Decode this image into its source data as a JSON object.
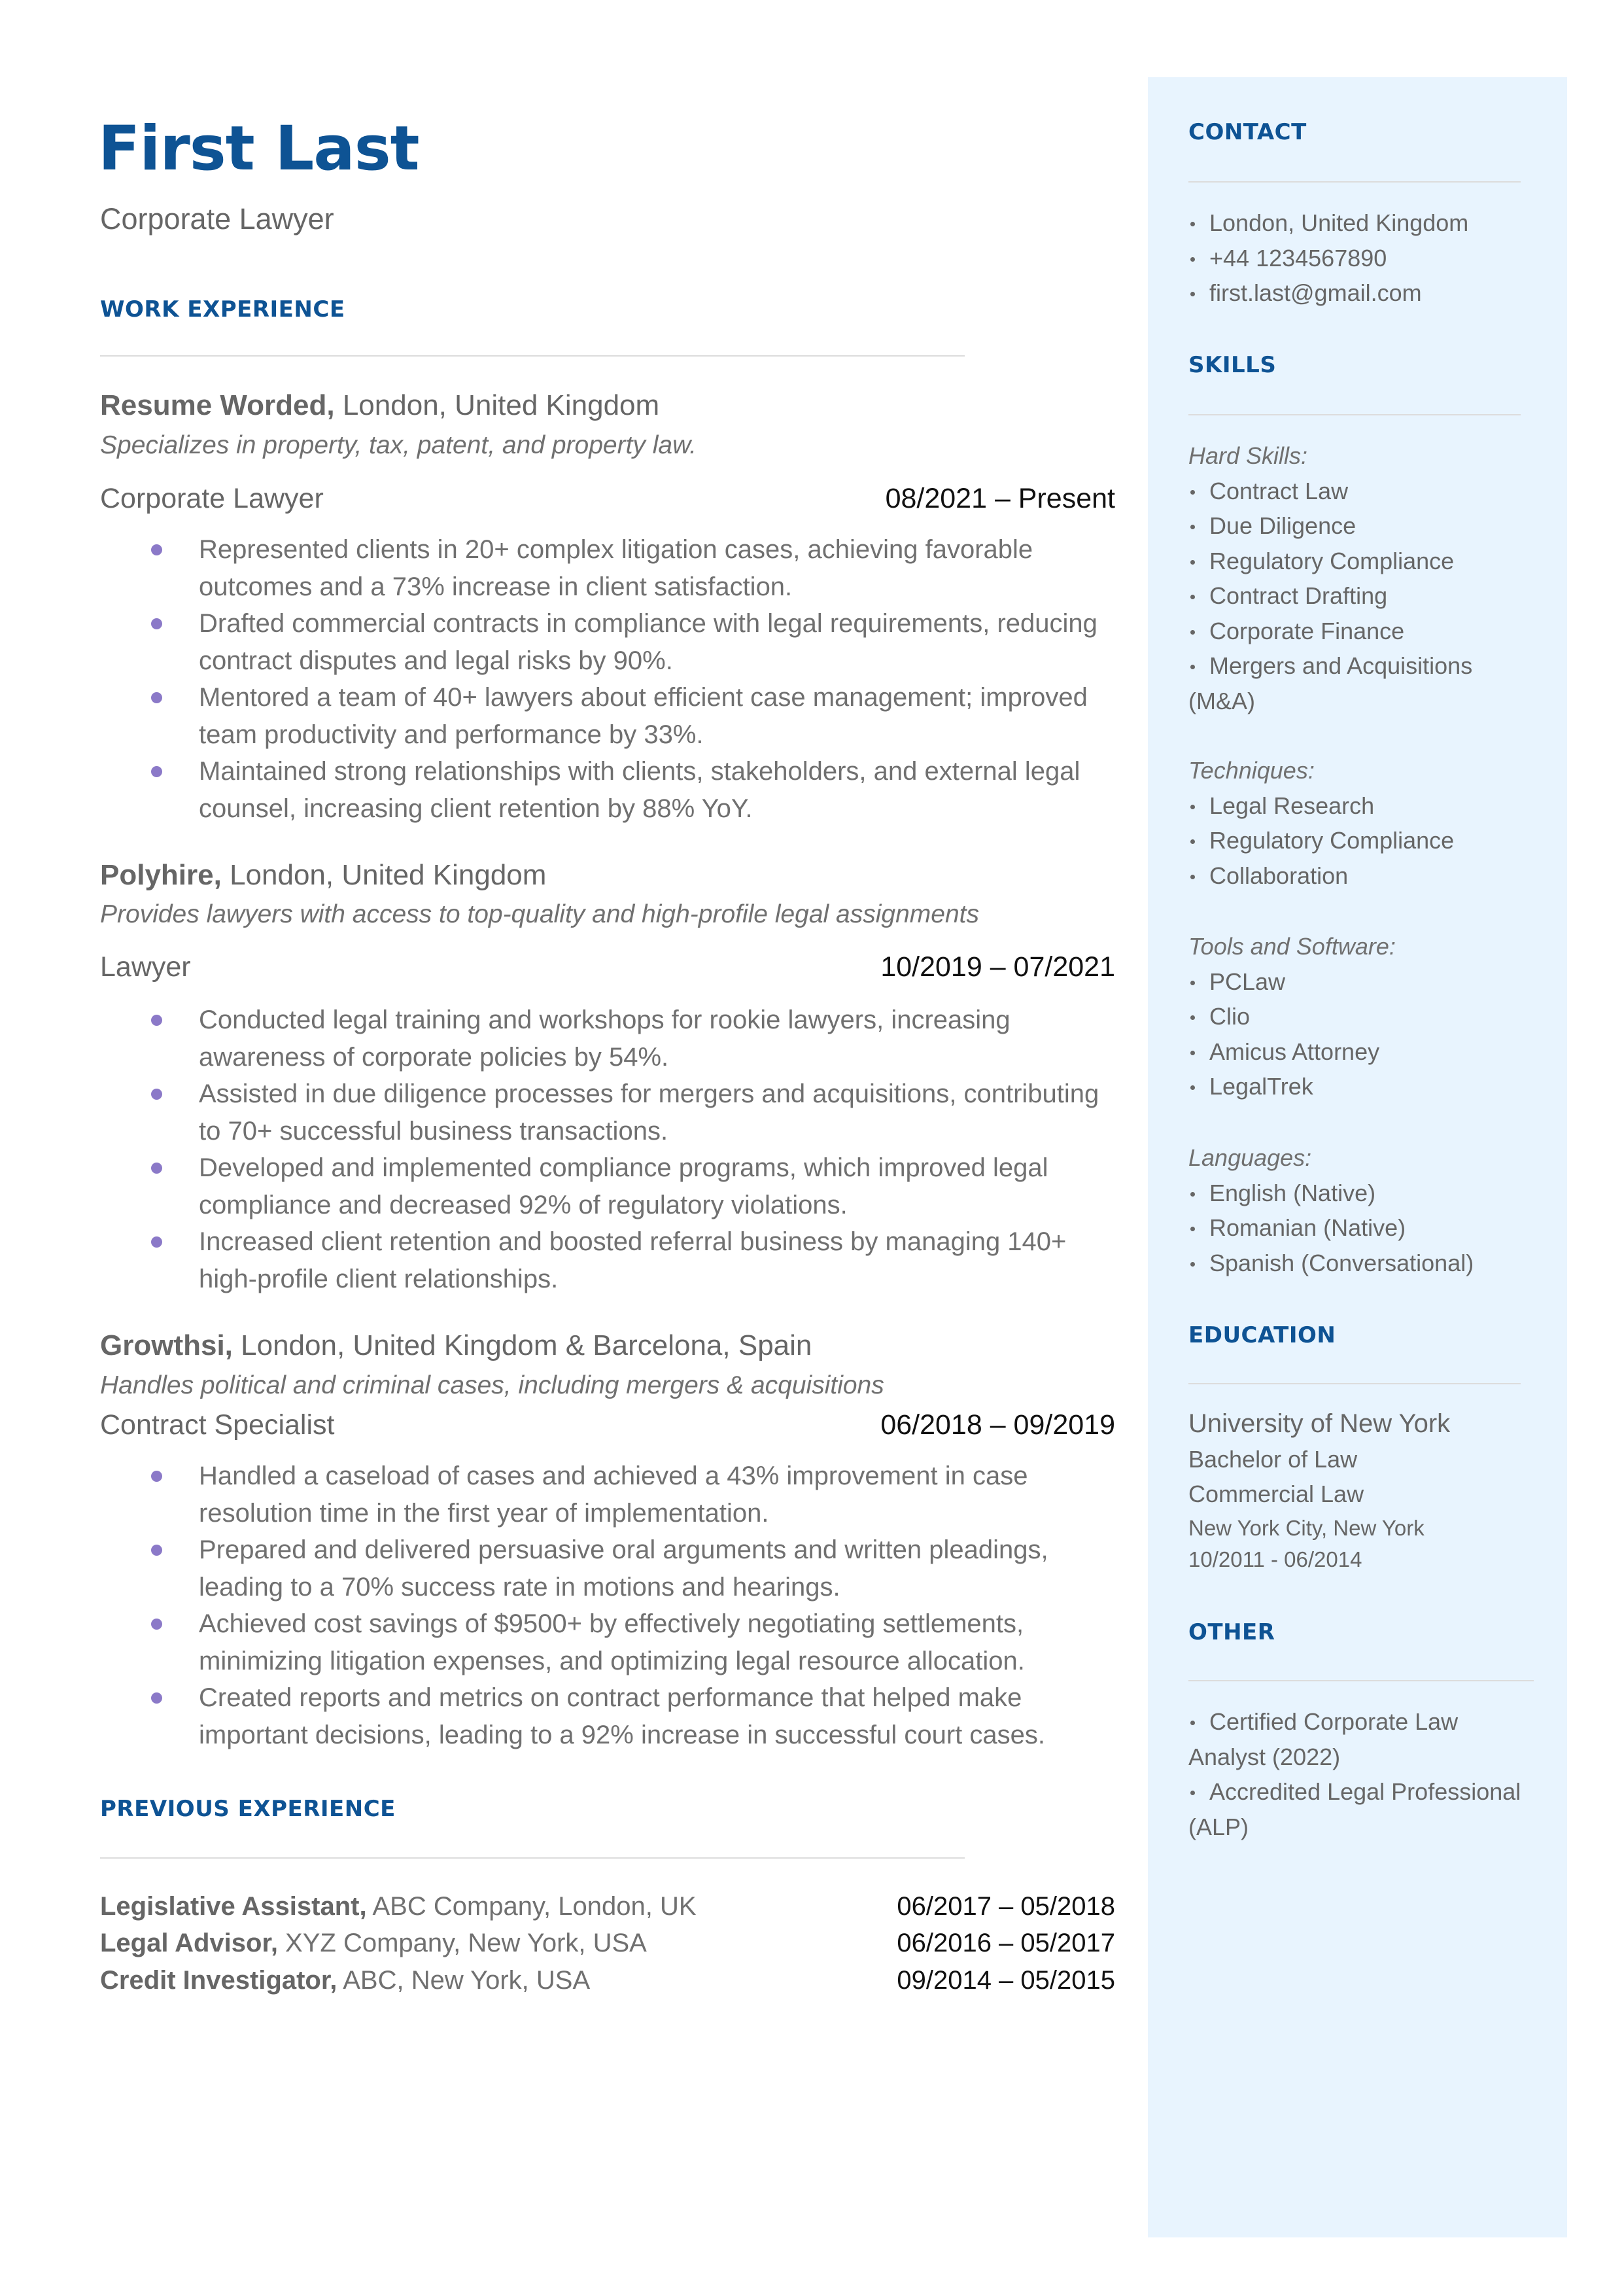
{
  "header": {
    "name": "First Last",
    "title": "Corporate Lawyer"
  },
  "colors": {
    "accent": "#0e5394",
    "bullet": "#8b79c8",
    "sidebar_bg": "#e8f4fe",
    "text": "#666666"
  },
  "work_experience": {
    "heading": "WORK EXPERIENCE",
    "jobs": [
      {
        "company": "Resume Worded,",
        "location": " London, United Kingdom",
        "description": "Specializes in property, tax, patent, and property law.",
        "role": "Corporate Lawyer",
        "dates": "08/2021 – Present",
        "bullets": [
          "Represented clients in 20+ complex litigation cases, achieving favorable outcomes and a 73% increase in client satisfaction.",
          "Drafted commercial contracts in compliance with legal requirements, reducing contract disputes and legal risks by 90%.",
          "Mentored a team of 40+ lawyers about efficient case management; improved team productivity and performance by 33%.",
          "Maintained strong relationships with clients, stakeholders, and external legal counsel, increasing client retention by 88% YoY."
        ]
      },
      {
        "company": "Polyhire,",
        "location": " London, United Kingdom",
        "description": "Provides lawyers with access to top-quality and high-profile legal assignments",
        "role": "Lawyer",
        "dates": "10/2019 – 07/2021",
        "bullets": [
          "Conducted legal training and workshops for rookie lawyers, increasing awareness of corporate policies by 54%.",
          "Assisted in due diligence processes for mergers and acquisitions, contributing to 70+ successful business transactions.",
          "Developed and implemented compliance programs, which improved legal compliance and decreased 92% of regulatory violations.",
          "Increased client retention and boosted referral business by managing 140+ high-profile client relationships."
        ]
      },
      {
        "company": "Growthsi,",
        "location": " London, United Kingdom & Barcelona, Spain",
        "description": "Handles political and criminal cases, including mergers & acquisitions",
        "role": "Contract Specialist",
        "dates": "06/2018 – 09/2019",
        "bullets": [
          "Handled a caseload of cases and achieved a 43% improvement in case resolution time in the first year of implementation.",
          "Prepared and delivered persuasive oral arguments and written pleadings, leading to a 70% success rate in motions and hearings.",
          "Achieved cost savings of $9500+ by effectively negotiating settlements, minimizing litigation expenses, and optimizing legal resource allocation.",
          "Created reports and metrics on contract performance that helped make important decisions, leading to a 92% increase in successful court cases."
        ]
      }
    ]
  },
  "previous_experience": {
    "heading": "PREVIOUS EXPERIENCE",
    "items": [
      {
        "role": "Legislative Assistant,",
        "org": " ABC Company, London, UK",
        "dates": "06/2017 – 05/2018"
      },
      {
        "role": "Legal Advisor,",
        "org": " XYZ Company, New York, USA",
        "dates": "06/2016 – 05/2017"
      },
      {
        "role": "Credit Investigator,",
        "org": " ABC, New York, USA",
        "dates": "09/2014 – 05/2015"
      }
    ]
  },
  "sidebar": {
    "contact": {
      "heading": "CONTACT",
      "items": [
        "London, United Kingdom",
        "+44 1234567890",
        "first.last@gmail.com"
      ]
    },
    "skills": {
      "heading": "SKILLS",
      "groups": [
        {
          "label": "Hard Skills:",
          "items": [
            "Contract Law",
            "Due Diligence",
            "Regulatory Compliance",
            "Contract Drafting",
            "Corporate Finance",
            "Mergers and Acquisitions (M&A)"
          ]
        },
        {
          "label": "Techniques:",
          "items": [
            "Legal Research",
            "Regulatory Compliance",
            "Collaboration"
          ]
        },
        {
          "label": "Tools and Software:",
          "items": [
            "PCLaw",
            "Clio",
            "Amicus Attorney",
            "LegalTrek"
          ]
        },
        {
          "label": "Languages:",
          "items": [
            "English (Native)",
            "Romanian (Native)",
            "Spanish (Conversational)"
          ]
        }
      ]
    },
    "education": {
      "heading": "EDUCATION",
      "school": "University of New York",
      "degree": "Bachelor of Law",
      "field": "Commercial Law",
      "location": "New York City, New York",
      "dates": "10/2011 - 06/2014"
    },
    "other": {
      "heading": "OTHER",
      "items": [
        "Certified Corporate Law Analyst (2022)",
        "Accredited Legal Professional (ALP)"
      ]
    }
  }
}
